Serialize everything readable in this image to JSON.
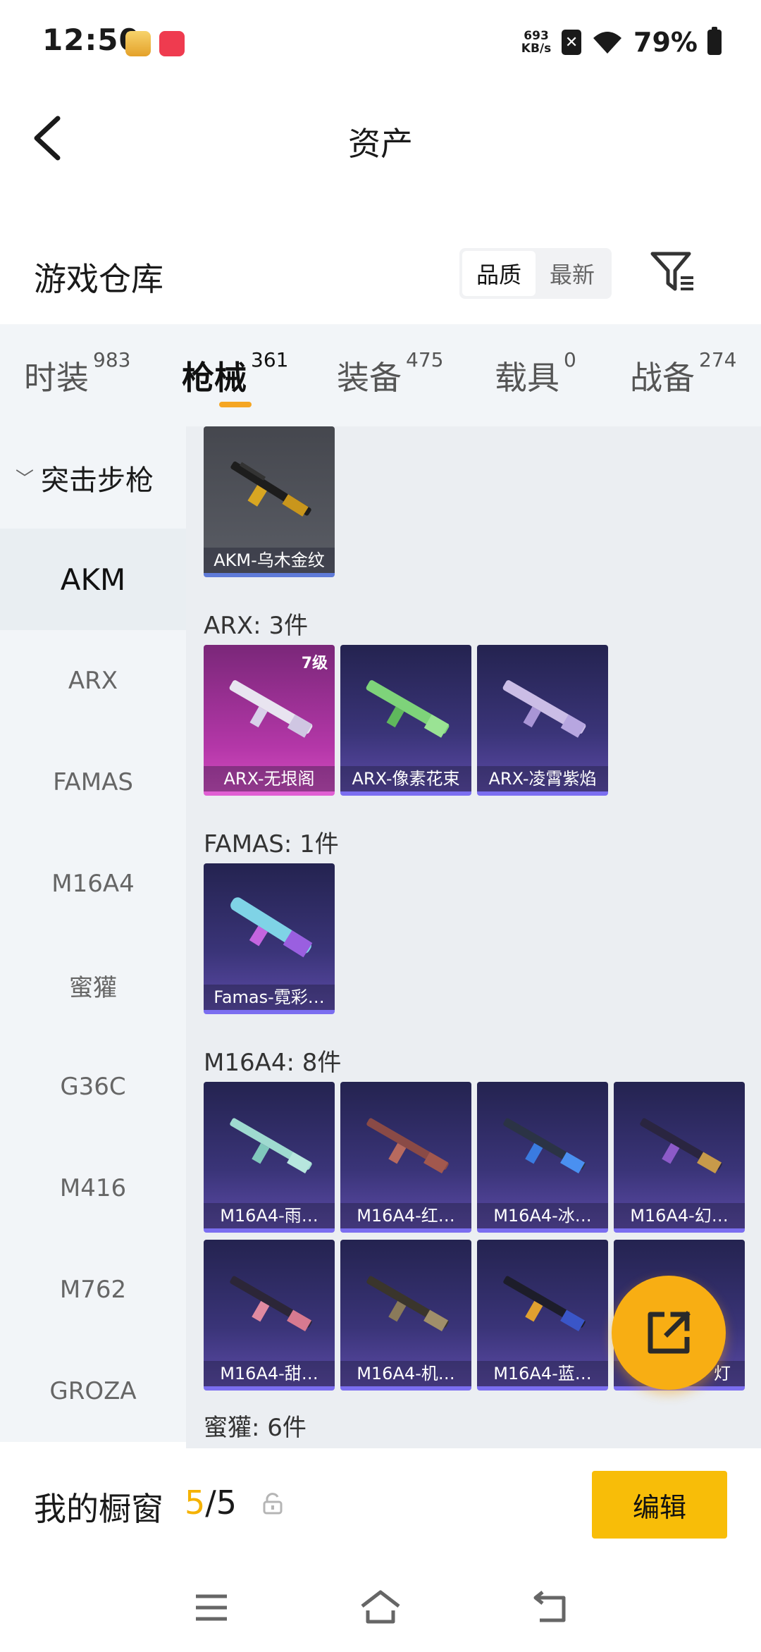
{
  "status_bar": {
    "time": "12:50",
    "net_speed_value": "693",
    "net_speed_unit": "KB/s",
    "battery": "79%"
  },
  "header": {
    "title": "资产",
    "back_icon": "back-arrow-icon"
  },
  "warehouse": {
    "title": "游戏仓库",
    "sort_options": [
      "品质",
      "最新"
    ],
    "sort_selected": "品质",
    "filter_icon": "filter-icon"
  },
  "tabs": [
    {
      "label": "时装",
      "count": "983"
    },
    {
      "label": "枪械",
      "count": "361"
    },
    {
      "label": "装备",
      "count": "475"
    },
    {
      "label": "载具",
      "count": "0"
    },
    {
      "label": "战备",
      "count": "274"
    }
  ],
  "sidebar": {
    "category": "突击步枪",
    "items": [
      "AKM",
      "ARX",
      "FAMAS",
      "M16A4",
      "蜜獾",
      "G36C",
      "M416",
      "M762",
      "GROZA"
    ],
    "selected": "AKM"
  },
  "content": {
    "akm_items": [
      {
        "name": "AKM-乌木金纹"
      }
    ],
    "arx_header": "ARX: 3件",
    "arx_items": [
      {
        "name": "ARX-无垠阁",
        "level": "7级"
      },
      {
        "name": "ARX-像素花束"
      },
      {
        "name": "ARX-凌霄紫焰"
      }
    ],
    "famas_header": "FAMAS: 1件",
    "famas_items": [
      {
        "name": "Famas-霓彩…"
      }
    ],
    "m16_header": "M16A4: 8件",
    "m16_items": [
      {
        "name": "M16A4-雨…"
      },
      {
        "name": "M16A4-红…"
      },
      {
        "name": "M16A4-冰…"
      },
      {
        "name": "M16A4-幻…"
      },
      {
        "name": "M16A4-甜…"
      },
      {
        "name": "M16A4-机…"
      },
      {
        "name": "M16A4-蓝…"
      },
      {
        "name": "灯"
      }
    ],
    "honey_header": "蜜獾: 6件"
  },
  "fab": {
    "icon": "share-icon"
  },
  "showcase": {
    "label": "我的橱窗",
    "current": "5",
    "separator": "/",
    "total": "5",
    "edit_label": "编辑"
  },
  "colors": {
    "accent": "#f8bd08",
    "tab_underline": "#f5a623",
    "purple_card": "#3a3478",
    "pink_card": "#b437a8"
  }
}
